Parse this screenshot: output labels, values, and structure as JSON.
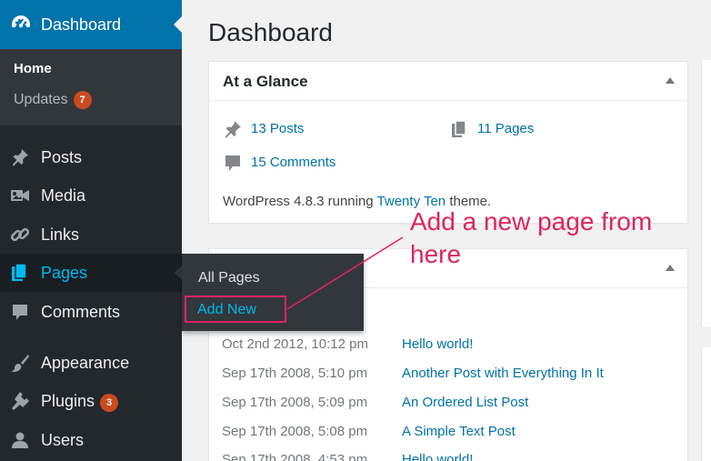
{
  "sidebar": {
    "dashboard_label": "Dashboard",
    "home_label": "Home",
    "updates_label": "Updates",
    "updates_count": "7",
    "items": [
      {
        "label": "Posts",
        "icon": "pin-icon"
      },
      {
        "label": "Media",
        "icon": "media-icon"
      },
      {
        "label": "Links",
        "icon": "link-icon"
      },
      {
        "label": "Pages",
        "icon": "pages-icon"
      },
      {
        "label": "Comments",
        "icon": "comment-icon"
      },
      {
        "label": "Appearance",
        "icon": "paintbrush-icon"
      },
      {
        "label": "Plugins",
        "icon": "plugin-icon"
      },
      {
        "label": "Users",
        "icon": "user-icon"
      }
    ],
    "plugins_count": "3"
  },
  "flyout": {
    "all_pages": "All Pages",
    "add_new": "Add New"
  },
  "main": {
    "title": "Dashboard",
    "glance": {
      "title": "At a Glance",
      "posts": "13 Posts",
      "pages": "11 Pages",
      "comments": "15 Comments",
      "info_prefix": "WordPress 4.8.3 running ",
      "theme": "Twenty Ten",
      "info_suffix": " theme."
    },
    "activity": [
      {
        "date": "Oct 2nd 2012, 10:12 pm",
        "title": "Hello world!"
      },
      {
        "date": "Sep 17th 2008, 5:10 pm",
        "title": "Another Post with Everything In It"
      },
      {
        "date": "Sep 17th 2008, 5:09 pm",
        "title": "An Ordered List Post"
      },
      {
        "date": "Sep 17th 2008, 5:08 pm",
        "title": "A Simple Text Post"
      },
      {
        "date": "Sep 17th 2008, 4:53 pm",
        "title": "Hello world!"
      }
    ]
  },
  "annotation": {
    "text": "Add a new page from here"
  },
  "colors": {
    "sidebar_bg": "#23282d",
    "accent": "#0073aa",
    "hover_text": "#00b9eb",
    "badge": "#ca4a1f",
    "annotation": "#e0245e"
  }
}
